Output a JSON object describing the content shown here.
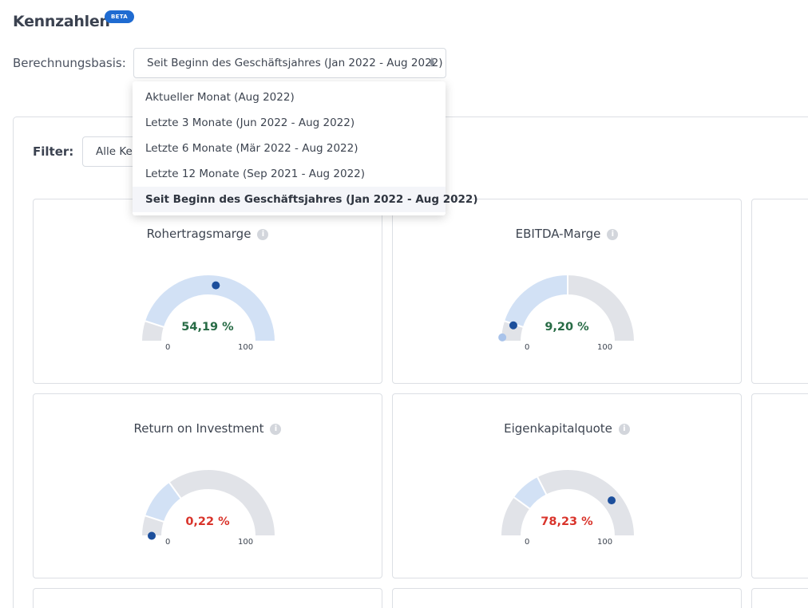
{
  "header": {
    "title": "Kennzahlen",
    "badge": "BETA"
  },
  "basis": {
    "label": "Berechnungsbasis:",
    "selected": "Seit Beginn des Geschäftsjahres (Jan 2022 - Aug 2022)",
    "options": [
      "Aktueller Monat (Aug 2022)",
      "Letzte 3 Monate (Jun 2022 - Aug 2022)",
      "Letzte 6 Monate (Mär 2022 - Aug 2022)",
      "Letzte 12 Monate (Sep 2021 - Aug 2022)",
      "Seit Beginn des Geschäftsjahres (Jan 2022 - Aug 2022)"
    ],
    "selected_index": 4
  },
  "filter": {
    "label": "Filter:",
    "value": "Alle Kennzahlen"
  },
  "colors": {
    "good": "#276b45",
    "bad": "#d9342b",
    "band": "#d2e1f5",
    "track": "#e1e3e8",
    "marker": "#1c4f9c",
    "marker_light": "#a9c3ea"
  },
  "cards": [
    {
      "title": "Rohertragsmarge",
      "value": "54,19 %",
      "status": "good",
      "min": "0",
      "max": "100",
      "progress": 54.19,
      "band_from": 10,
      "band_to": 100,
      "marker_percent": 54.19
    },
    {
      "title": "EBITDA-Marge",
      "value": "9,20 %",
      "status": "good",
      "min": "0",
      "max": "100",
      "progress": 9.2,
      "band_from": 10,
      "band_to": 50,
      "marker_percent": 9.2,
      "secondary_marker_percent": 2
    },
    {
      "title": "Return on Investment",
      "value": "0,22 %",
      "status": "bad",
      "min": "0",
      "max": "100",
      "progress": 0.22,
      "band_from": 10,
      "band_to": 30,
      "marker_percent": 0.22
    },
    {
      "title": "Eigenkapitalquote",
      "value": "78,23 %",
      "status": "bad",
      "min": "0",
      "max": "100",
      "progress": 78.23,
      "band_from": 20,
      "band_to": 35,
      "marker_percent": 78.23
    }
  ]
}
